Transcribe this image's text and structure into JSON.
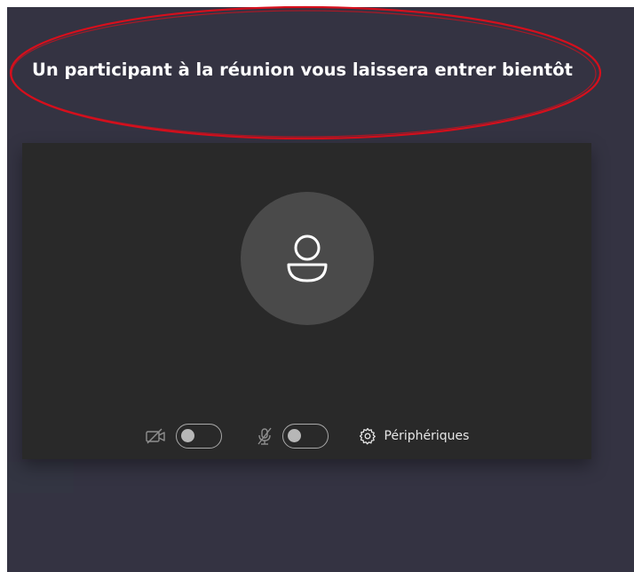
{
  "lobby": {
    "title": "Un participant à la réunion vous laissera entrer bientôt",
    "annotation_color": "#d60f1c"
  },
  "preview": {
    "avatar_icon": "person-icon",
    "camera": {
      "icon": "camera-off-icon",
      "toggle": "off"
    },
    "microphone": {
      "icon": "mic-off-icon",
      "toggle": "off"
    },
    "devices": {
      "icon": "gear-icon",
      "label": "Périphériques"
    }
  },
  "colors": {
    "background": "#343342",
    "card": "#292929",
    "avatar": "#4a4a4a",
    "text": "#ffffff"
  }
}
